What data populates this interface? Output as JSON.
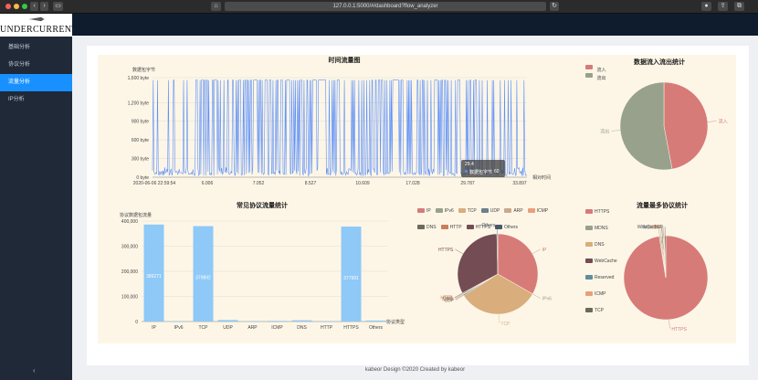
{
  "browser": {
    "url": "127.0.0.1:5000/#/dashboard?flow_analyzer"
  },
  "sidebar": {
    "logo_text": "UNDERCURRENT",
    "items": [
      {
        "label": "基础分析"
      },
      {
        "label": "协议分析"
      },
      {
        "label": "流量分析",
        "active": true
      },
      {
        "label": "IP分析"
      }
    ],
    "collapse_icon": "‹"
  },
  "footer": "kabeor Design ©2020 Created by kabeor",
  "colors": {
    "accent": "#1890ff",
    "line": "#5b8ff9",
    "bar": "#8ec9f7",
    "pie_red": "#d77b78",
    "pie_green": "#98a18c",
    "pie_tan": "#d9ad7c",
    "pie_plum": "#744c54"
  },
  "chart_data": [
    {
      "type": "line",
      "title": "时间流量图",
      "ylabel": "数据包字节",
      "xlabel": "相对时间",
      "yticks": [
        "0 byte",
        "300 byte",
        "600 byte",
        "900 byte",
        "1,200 byte",
        "1,600 byte"
      ],
      "ylim": [
        0,
        1600
      ],
      "xticks": [
        "2020-06-06 22:59:54",
        "6.006",
        "7.052",
        "8.527",
        "10.609",
        "17.028",
        "29.787",
        "33.897"
      ],
      "tooltip": {
        "title": "29.4",
        "label": "数据包字节",
        "value": "60"
      }
    },
    {
      "type": "pie",
      "title": "数据流入流出统计",
      "legend": [
        "流入",
        "流出"
      ],
      "labels": [
        "流入",
        "流出"
      ],
      "values": [
        47,
        53
      ]
    },
    {
      "type": "bar",
      "title": "常见协议流量统计",
      "ylabel": "协议数据包流量",
      "xlabel": "协议类型",
      "categories": [
        "IP",
        "IPv6",
        "TCP",
        "UDP",
        "ARP",
        "ICMP",
        "DNS",
        "HTTP",
        "HTTPS",
        "Others"
      ],
      "values": [
        386271,
        0,
        379892,
        6000,
        300,
        2500,
        5000,
        200,
        377991,
        4000
      ],
      "data_labels": [
        "386271",
        "",
        "379892",
        "",
        "",
        "",
        "",
        "",
        "377991",
        ""
      ],
      "yticks": [
        "0",
        "100,000",
        "200,000",
        "300,000",
        "400,000"
      ],
      "ylim": [
        0,
        400000
      ]
    },
    {
      "type": "pie",
      "legend": [
        "IP",
        "IPv6",
        "TCP",
        "UDP",
        "ARP",
        "ICMP",
        "DNS",
        "HTTP",
        "HTTPS",
        "Others"
      ],
      "labels": [
        "IP",
        "IPv6",
        "TCP",
        "UDP",
        "ARP",
        "ICMP",
        "DNS",
        "HTTP",
        "HTTPS",
        "Others"
      ],
      "values": [
        386271,
        100,
        379892,
        6000,
        300,
        2500,
        5000,
        200,
        377991,
        4000
      ]
    },
    {
      "type": "pie",
      "title": "流量最多协议统计",
      "legend": [
        "HTTPS",
        "MDNS",
        "DNS",
        "WebCache",
        "Reserved",
        "ICMP",
        "TCP"
      ],
      "labels": [
        "HTTPS",
        "MDNS",
        "DNS",
        "WebCache",
        "Reserved",
        "ICMP",
        "TCP"
      ],
      "values": [
        97.5,
        0.4,
        0.6,
        0.4,
        0.3,
        0.3,
        0.5
      ]
    }
  ]
}
